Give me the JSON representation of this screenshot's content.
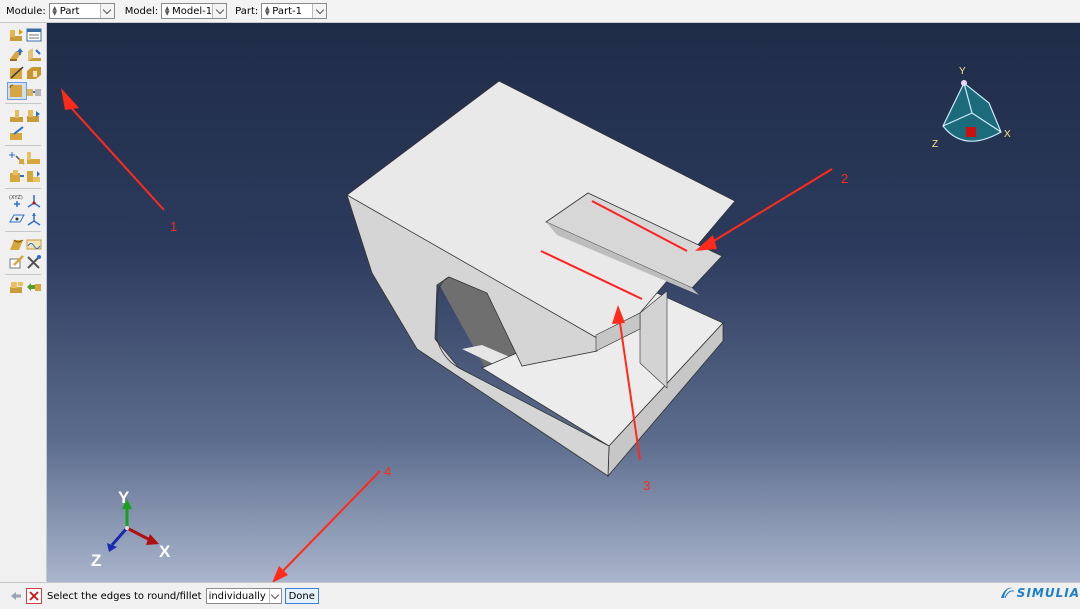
{
  "context_bar": {
    "module_label": "Module:",
    "module_value": "Part",
    "model_label": "Model:",
    "model_value": "Model-1",
    "part_label": "Part:",
    "part_value": "Part-1"
  },
  "toolbox": {
    "icons": [
      "create-part-icon",
      "part-manager-icon",
      "create-solid-extrude-icon",
      "create-shell-icon",
      "create-wire-icon",
      "create-cut-icon",
      "create-round-fillet-icon",
      "create-chamfer-icon",
      "create-partition-icon",
      "create-datum-icon",
      "edit-feature-icon",
      "query-icon",
      "create-sketch-icon",
      "attribute-icon",
      "mesh-part-icon",
      "datum-point-icon",
      "datum-axis-icon",
      "datum-plane-icon",
      "datum-csys-icon",
      "repair-icon",
      "wire-repair-icon",
      "feature-manipulation-icon",
      "tools-icon",
      "part-instance-icon",
      "replace-icon"
    ],
    "active_tool": "create-round-fillet-icon"
  },
  "viewport": {
    "annotations": [
      "1",
      "2",
      "3",
      "4"
    ],
    "annotation_color": "#ff2a1a",
    "view_triad_labels": {
      "y": "Y",
      "x": "X",
      "z": "Z"
    },
    "axis_triad_labels": {
      "y": "Y",
      "x": "X",
      "z": "Z"
    }
  },
  "prompt_bar": {
    "text": "Select the edges to round/fillet",
    "mode_value": "individually",
    "done_label": "Done",
    "brand": "SIMULIA"
  }
}
